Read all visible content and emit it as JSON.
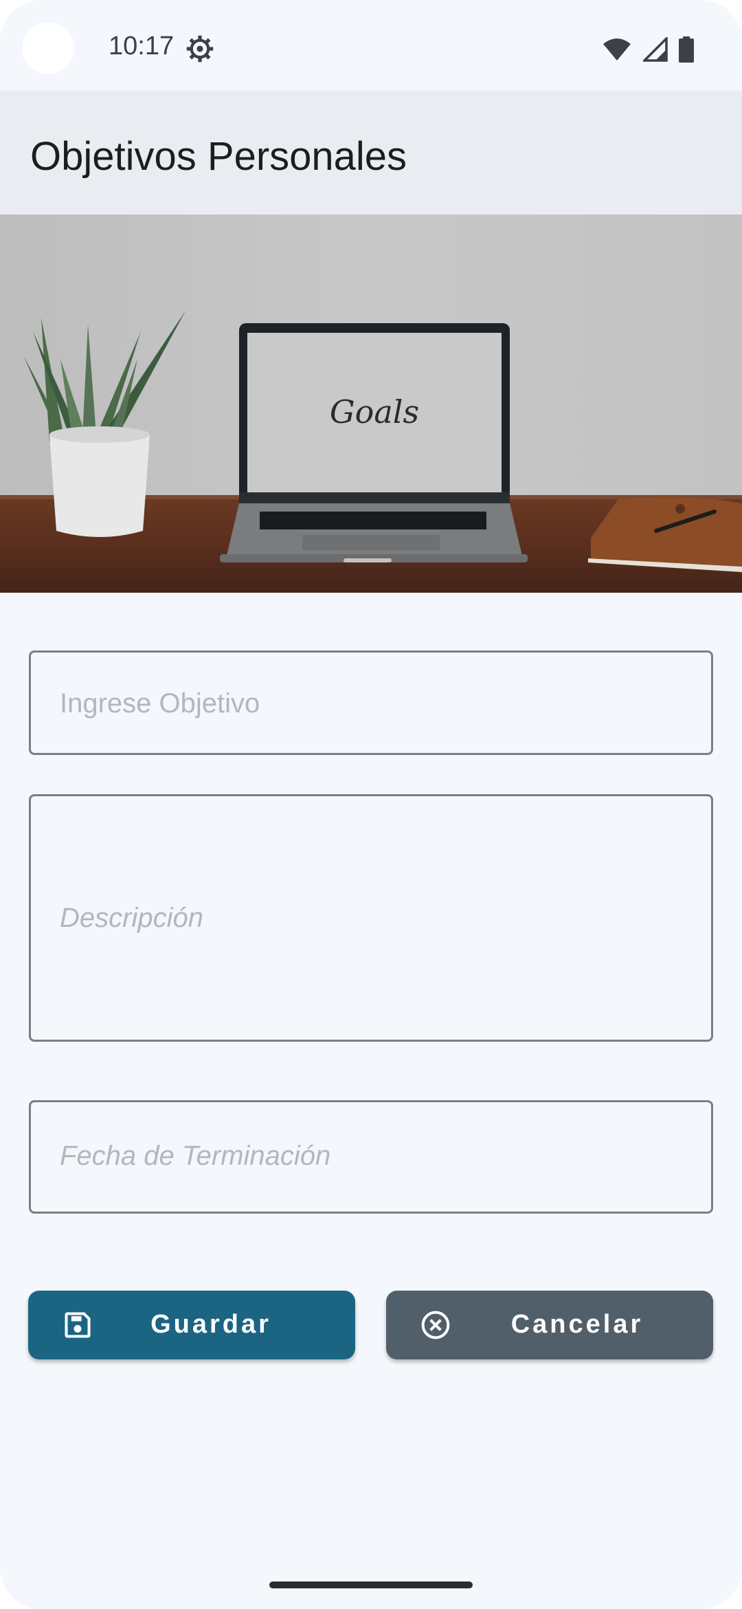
{
  "status_bar": {
    "time": "10:17",
    "icons": [
      "settings-gear-icon",
      "wifi-icon",
      "cell-signal-icon",
      "battery-icon"
    ]
  },
  "app_bar": {
    "title": "Objetivos Personales"
  },
  "hero": {
    "screen_text": "Goals"
  },
  "form": {
    "objective_placeholder": "Ingrese Objetivo",
    "description_placeholder": "Descripción",
    "end_date_placeholder": "Fecha de Terminación"
  },
  "buttons": {
    "save_label": "Guardar",
    "save_icon": "save-icon",
    "cancel_label": "Cancelar",
    "cancel_icon": "cancel-circle-icon"
  },
  "colors": {
    "app_bar_bg": "#e9ecf1",
    "page_bg": "#f4f7fc",
    "save_button": "#1b6583",
    "cancel_button": "#505f6a"
  }
}
